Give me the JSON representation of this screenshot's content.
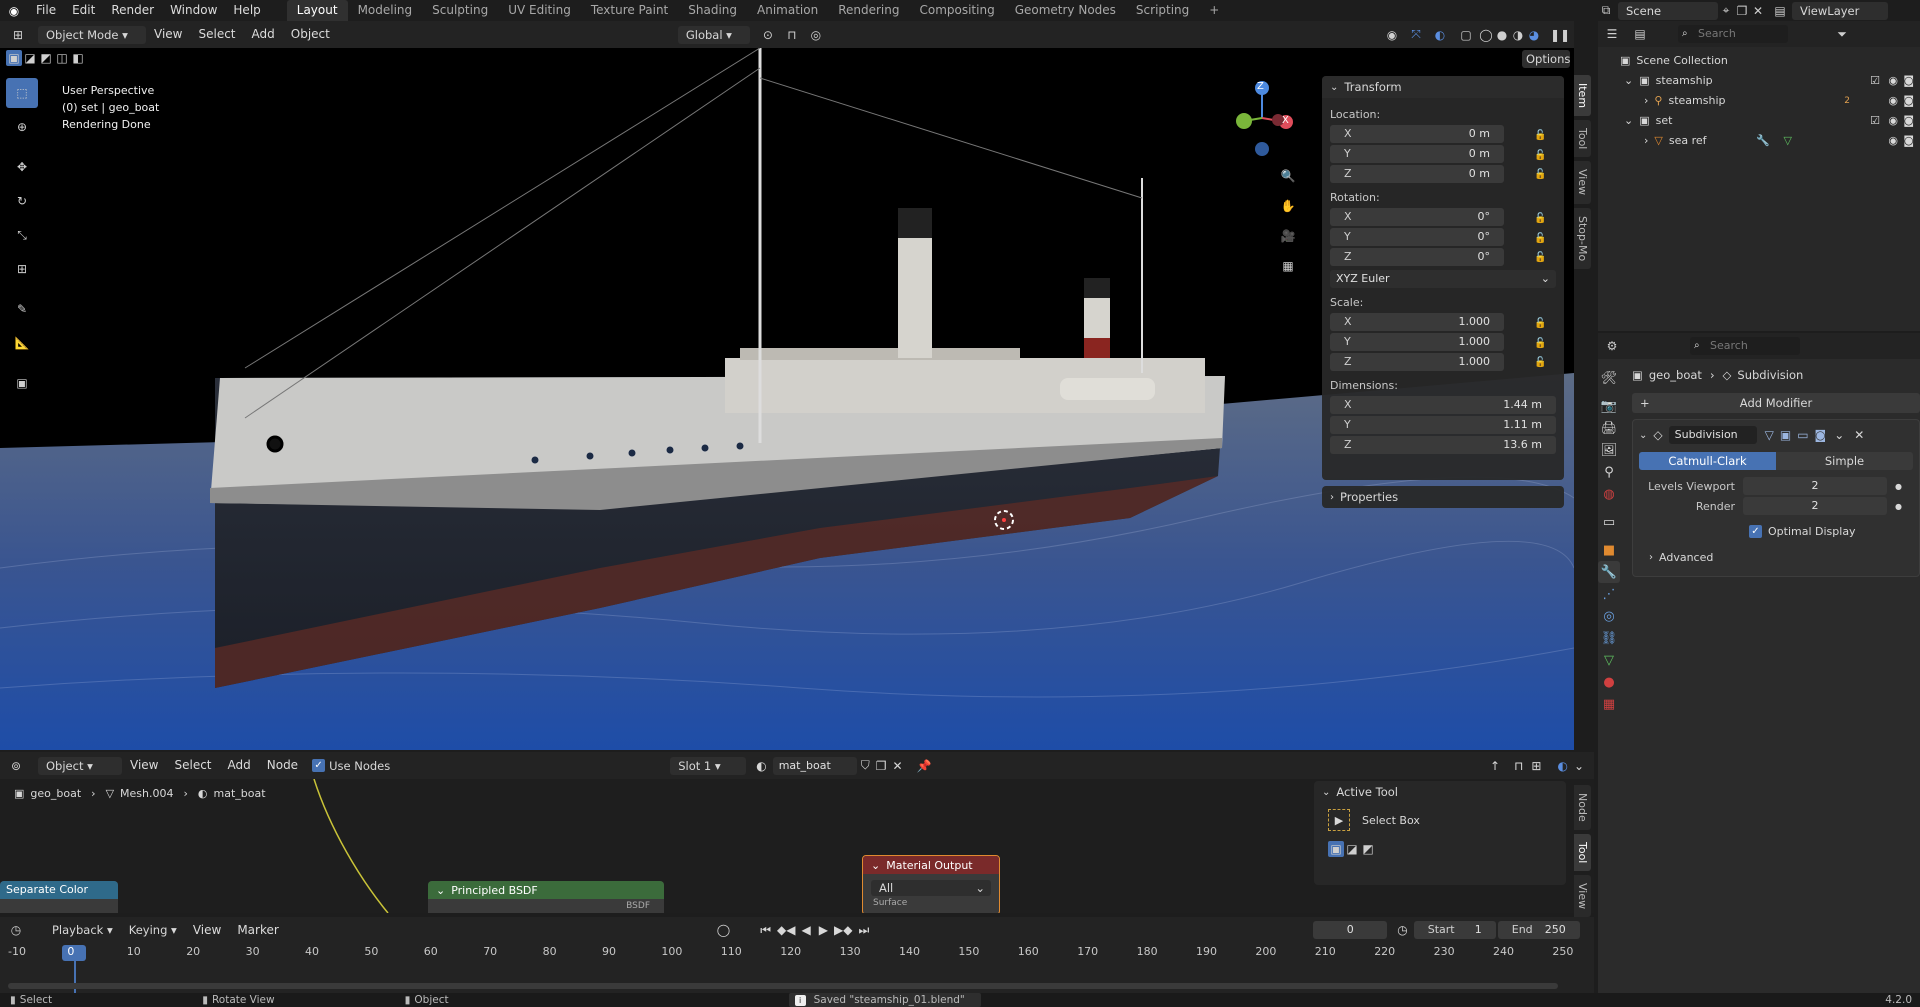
{
  "topbar": {
    "menus": [
      "File",
      "Edit",
      "Render",
      "Window",
      "Help"
    ],
    "workspaces": [
      "Layout",
      "Modeling",
      "Sculpting",
      "UV Editing",
      "Texture Paint",
      "Shading",
      "Animation",
      "Rendering",
      "Compositing",
      "Geometry Nodes",
      "Scripting"
    ],
    "active_workspace": "Layout",
    "add_tab": "+",
    "scene": "Scene",
    "view_layer": "ViewLayer"
  },
  "viewport_header": {
    "mode": "Object Mode",
    "menus": [
      "View",
      "Select",
      "Add",
      "Object"
    ],
    "orientation": "Global",
    "options": "Options"
  },
  "viewport": {
    "overlay_line1": "User Perspective",
    "overlay_line2": "(0) set | geo_boat",
    "overlay_line3": "Rendering Done",
    "gizmo": {
      "x": "X",
      "y": "Y",
      "z": "Z"
    }
  },
  "npanel": {
    "tabs": [
      "Item",
      "Tool",
      "View",
      "Stop-Mo"
    ],
    "transform_title": "Transform",
    "location_label": "Location:",
    "location": [
      {
        "k": "X",
        "v": "0 m"
      },
      {
        "k": "Y",
        "v": "0 m"
      },
      {
        "k": "Z",
        "v": "0 m"
      }
    ],
    "rotation_label": "Rotation:",
    "rotation": [
      {
        "k": "X",
        "v": "0°"
      },
      {
        "k": "Y",
        "v": "0°"
      },
      {
        "k": "Z",
        "v": "0°"
      }
    ],
    "rotation_mode": "XYZ Euler",
    "scale_label": "Scale:",
    "scale": [
      {
        "k": "X",
        "v": "1.000"
      },
      {
        "k": "Y",
        "v": "1.000"
      },
      {
        "k": "Z",
        "v": "1.000"
      }
    ],
    "dimensions_label": "Dimensions:",
    "dimensions": [
      {
        "k": "X",
        "v": "1.44 m"
      },
      {
        "k": "Y",
        "v": "1.11 m"
      },
      {
        "k": "Z",
        "v": "13.6 m"
      }
    ],
    "properties_title": "Properties"
  },
  "outliner": {
    "search_placeholder": "Search",
    "root": "Scene Collection",
    "items": [
      {
        "label": "steamship",
        "indent": 0
      },
      {
        "label": "steamship",
        "indent": 1,
        "badge": "2"
      },
      {
        "label": "set",
        "indent": 0
      },
      {
        "label": "sea ref",
        "indent": 1
      }
    ]
  },
  "properties": {
    "search_placeholder": "Search",
    "object": "geo_boat",
    "modifier_crumb": "Subdivision",
    "add_modifier": "Add Modifier",
    "modifier_name": "Subdivision",
    "subdiv_types": [
      "Catmull-Clark",
      "Simple"
    ],
    "levels_viewport_label": "Levels Viewport",
    "levels_viewport": "2",
    "render_label": "Render",
    "render": "2",
    "optimal_display": "Optimal Display",
    "advanced": "Advanced"
  },
  "node_editor": {
    "type": "Object",
    "menus": [
      "View",
      "Select",
      "Add",
      "Node"
    ],
    "use_nodes": "Use Nodes",
    "slot": "Slot 1",
    "material": "mat_boat",
    "breadcrumb": [
      "geo_boat",
      "Mesh.004",
      "mat_boat"
    ],
    "nodes": {
      "separate": "Separate Color",
      "principled": "Principled BSDF",
      "principled_out": "BSDF",
      "output": "Material Output",
      "output_target": "All",
      "output_in": "Surface"
    },
    "tabs": [
      "Node",
      "Tool",
      "View"
    ],
    "active_tool_title": "Active Tool",
    "active_tool": "Select Box"
  },
  "timeline": {
    "menus": [
      "Playback",
      "Keying",
      "View",
      "Marker"
    ],
    "current_frame": "0",
    "start_label": "Start",
    "start": "1",
    "end_label": "End",
    "end": "250",
    "ticks": [
      "-10",
      "0",
      "10",
      "20",
      "30",
      "40",
      "50",
      "60",
      "70",
      "80",
      "90",
      "100",
      "110",
      "120",
      "130",
      "140",
      "150",
      "160",
      "170",
      "180",
      "190",
      "200",
      "210",
      "220",
      "230",
      "240",
      "250"
    ]
  },
  "statusbar": {
    "select": "Select",
    "rotate": "Rotate View",
    "object": "Object",
    "message": "Saved \"steamship_01.blend\"",
    "version": "4.2.0"
  },
  "colors": {
    "accent": "#4772b3",
    "node_green": "#3b6b3b",
    "node_red": "#7a2a2a",
    "node_blue": "#2f6a8a"
  }
}
